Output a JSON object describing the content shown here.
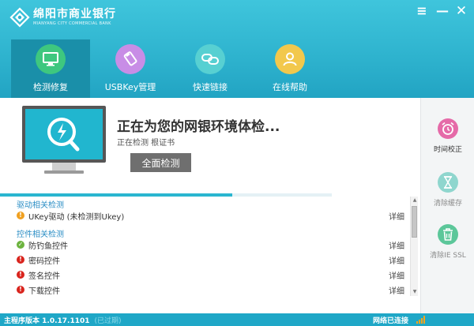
{
  "app": {
    "name_cn": "绵阳市商业银行",
    "name_en": "MIANYANG CITY COMMERCIAL BANK"
  },
  "window_controls": {
    "menu": "≡",
    "minimize": "—",
    "close": "✕"
  },
  "nav": {
    "items": [
      {
        "label": "检测修复",
        "icon": "monitor-icon",
        "color": "#3ec77f",
        "active": true
      },
      {
        "label": "USBKey管理",
        "icon": "usbkey-icon",
        "color": "#c88de6",
        "active": false
      },
      {
        "label": "快速链接",
        "icon": "link-icon",
        "color": "#57d0d2",
        "active": false
      },
      {
        "label": "在线帮助",
        "icon": "user-icon",
        "color": "#f2c84c",
        "active": false
      }
    ]
  },
  "scan": {
    "title": "正在为您的网银环境体检...",
    "subtitle": "正在检测 根证书",
    "button": "全面检测",
    "progress": 0.7
  },
  "checks": {
    "groups": [
      {
        "title": "驱动相关检测",
        "items": [
          {
            "label": "UKey驱动 (未检测到Ukey)",
            "status": "warning",
            "detail": "详细"
          }
        ]
      },
      {
        "title": "控件相关检测",
        "items": [
          {
            "label": "防钓鱼控件",
            "status": "ok",
            "detail": "详细"
          },
          {
            "label": "密码控件",
            "status": "error",
            "detail": "详细"
          },
          {
            "label": "签名控件",
            "status": "error",
            "detail": "详细"
          },
          {
            "label": "下载控件",
            "status": "error",
            "detail": "详细"
          }
        ]
      }
    ]
  },
  "tools": [
    {
      "label": "时间校正",
      "icon": "alarm-clock-icon",
      "color": "#e56aa8"
    },
    {
      "label": "清除缓存",
      "icon": "hourglass-icon",
      "color": "#8fd6ce"
    },
    {
      "label": "清除IE SSL",
      "icon": "trash-icon",
      "color": "#5cc79a"
    }
  ],
  "status_bar": {
    "version": "主程序版本 1.0.17.1101",
    "version_extra": "(已过期)",
    "network": "网络已连接"
  },
  "colors": {
    "header": "#2fb4cf",
    "nav_active": "#1a8fa9",
    "accent_blue": "#2b8ec5",
    "status_bar": "#1fa7c7"
  }
}
